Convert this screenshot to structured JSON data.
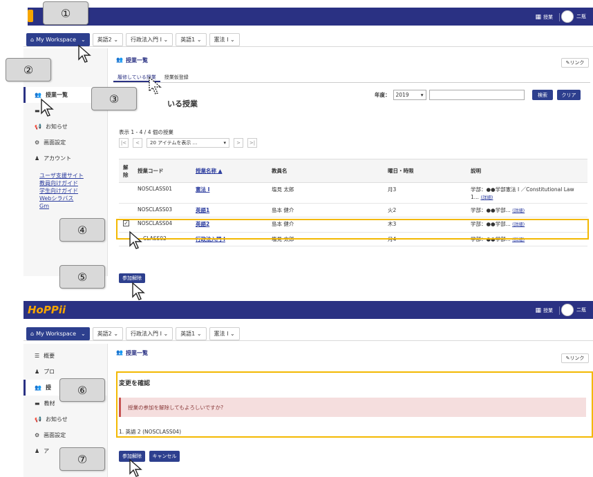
{
  "top": {
    "logo": "HoPPii",
    "grid_label": "授業",
    "user_name": "二瓶"
  },
  "subnav": {
    "workspace": "My Workspace",
    "tabs": [
      "英語2",
      "行政法入門 I",
      "英語1",
      "憲法 I"
    ]
  },
  "sidebar_top": {
    "items": [
      {
        "label": "授業一覧",
        "icon": "people-icon"
      },
      {
        "label": "教材",
        "icon": "folder-icon"
      },
      {
        "label": "お知らせ",
        "icon": "megaphone-icon"
      },
      {
        "label": "画面設定",
        "icon": "gear-icon"
      },
      {
        "label": "アカウント",
        "icon": "person-icon"
      }
    ],
    "links": [
      "ユーザ支援サイト",
      "教員向けガイド",
      "学生向けガイド",
      "Webシラバス",
      "Gm"
    ]
  },
  "sidebar_bottom": {
    "items": [
      {
        "label": "概要",
        "icon": "list-icon"
      },
      {
        "label": "プロ",
        "icon": "person-icon"
      },
      {
        "label": "授",
        "icon": "people-icon"
      },
      {
        "label": "教材",
        "icon": "folder-icon"
      },
      {
        "label": "お知らせ",
        "icon": "megaphone-icon"
      },
      {
        "label": "画面設定",
        "icon": "gear-icon"
      },
      {
        "label": "ア",
        "icon": "person-icon"
      }
    ]
  },
  "main_top": {
    "title": "授業一覧",
    "link_button": "✎リンク",
    "tabs": [
      "履修している授業",
      "授業仮登録"
    ],
    "heading": "いる授業",
    "year_label": "年度：",
    "year_value": "2019",
    "search_button": "検索",
    "clear_button": "クリア",
    "count_text": "表示 1 - 4 / 4 個の授業",
    "page_size": "20 アイテムを表示 ...",
    "columns": [
      "解除",
      "授業コード",
      "授業名称 ▲",
      "教員名",
      "曜日・時限",
      "説明"
    ],
    "rows": [
      {
        "code": "NOSCLASS01",
        "name": "憲法 I",
        "teacher": "塩見 太郎",
        "period": "月3",
        "desc": "学部：●●学部憲法 I ／Constitutional Law 1...",
        "more": "(詳細)",
        "checked": false
      },
      {
        "code": "NOSCLASS03",
        "name": "英語1",
        "teacher": "島本 健介",
        "period": "火2",
        "desc": "学部：●●学部...",
        "more": "(詳細)",
        "checked": false
      },
      {
        "code": "NOSCLASS04",
        "name": "英語2",
        "teacher": "島本 健介",
        "period": "木3",
        "desc": "学部：●●学部...",
        "more": "(詳細)",
        "checked": true
      },
      {
        "code": "CLASS02",
        "name": "行政法入門 I",
        "teacher": "塩見 太郎",
        "period": "月4",
        "desc": "学部：●●学部...",
        "more": "(詳細)",
        "checked": false
      }
    ],
    "unenroll_button": "参加解除"
  },
  "main_bottom": {
    "title": "授業一覧",
    "link_button": "✎リンク",
    "confirm_heading": "変更を確認",
    "alert_text": "授業の参加を解除してもよろしいですか?",
    "item_text": "1. 英語 2 (NOSCLASS04)",
    "unenroll_button": "参加解除",
    "cancel_button": "キャンセル"
  },
  "callouts": [
    "①",
    "②",
    "③",
    "④",
    "⑤",
    "⑥",
    "⑦"
  ],
  "colors": {
    "header": "#2a3183",
    "highlight": "#f3b800",
    "alert_bg": "#f5dede",
    "alert_border": "#c65353"
  }
}
